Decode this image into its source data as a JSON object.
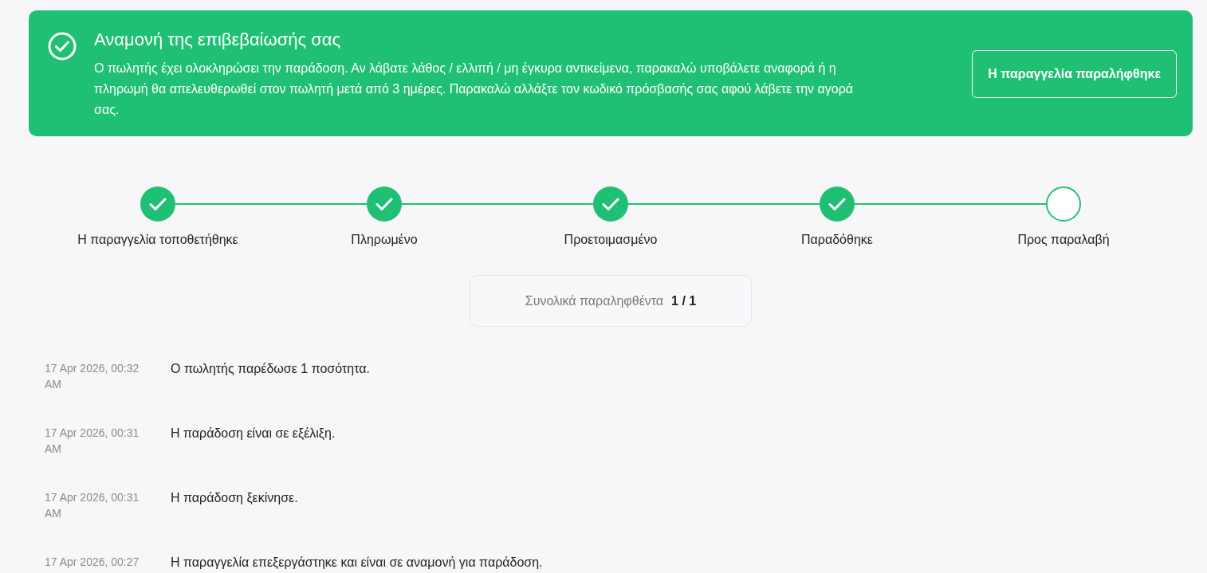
{
  "banner": {
    "title": "Αναμονή της επιβεβαίωσής σας",
    "message": "Ο πωλητής έχει ολοκληρώσει την παράδοση. Αν λάβατε λάθος / ελλιπή / μη έγκυρα αντικείμενα, παρακαλώ υποβάλετε αναφορά ή η πληρωμή θα απελευθερωθεί στον πωλητή μετά από 3 ημέρες. Παρακαλώ αλλάξτε τον κωδικό πρόσβασής σας αφού λάβετε την αγορά σας.",
    "button": "Η παραγγελία παραλήφθηκε"
  },
  "steps": [
    {
      "label": "Η παραγγελία τοποθετήθηκε",
      "completed": true
    },
    {
      "label": "Πληρωμένο",
      "completed": true
    },
    {
      "label": "Προετοιμασμένο",
      "completed": true
    },
    {
      "label": "Παραδόθηκε",
      "completed": true
    },
    {
      "label": "Προς παραλαβή",
      "completed": false
    }
  ],
  "summary": {
    "label": "Συνολικά παραληφθέντα",
    "value": "1 / 1"
  },
  "events": [
    {
      "time": "17 Apr 2026, 00:32 AM",
      "message": "Ο πωλητής παρέδωσε 1 ποσότητα."
    },
    {
      "time": "17 Apr 2026, 00:31 AM",
      "message": "Η παράδοση είναι σε εξέλιξη."
    },
    {
      "time": "17 Apr 2026, 00:31 AM",
      "message": "Η παράδοση ξεκίνησε."
    },
    {
      "time": "17 Apr 2026, 00:27",
      "message": "Η παραγγελία επεξεργάστηκε και είναι σε αναμονή για παράδοση."
    }
  ]
}
